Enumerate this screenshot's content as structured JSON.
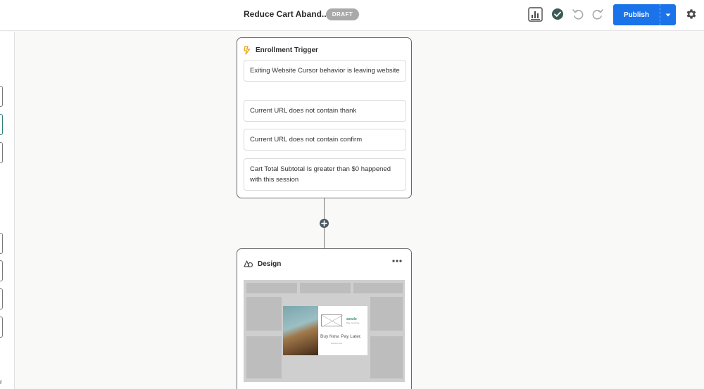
{
  "header": {
    "title": "Reduce Cart Aband...",
    "status_badge": "DRAFT",
    "publish_label": "Publish",
    "icons": [
      "report-icon",
      "check-circle-icon",
      "undo-icon",
      "redo-icon",
      "gear-icon",
      "caret-down-icon"
    ]
  },
  "colors": {
    "primary": "#1a73e8",
    "badge": "#a9a9a9",
    "check": "#3c5a55",
    "trigger_icon": "#e8a21a"
  },
  "left_panel": {
    "footer_text": "r"
  },
  "trigger": {
    "title": "Enrollment Trigger",
    "conditions": [
      "Exiting Website Cursor behavior is leaving website",
      "Current URL does not contain thank",
      "Current URL does not contain confirm",
      "Cart Total Subtotal Is greater than $0 happened with this session"
    ]
  },
  "design": {
    "title": "Design",
    "preview": {
      "brand": "sezzle",
      "tagline": "Pay over time",
      "headline": "Buy Now. Pay Later.",
      "subtext": "interest-free"
    }
  }
}
